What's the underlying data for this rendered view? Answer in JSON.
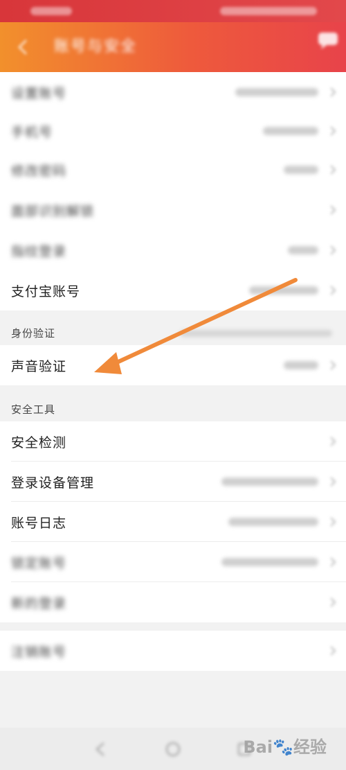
{
  "header": {
    "title": "账号与安全"
  },
  "rows_top": [
    {
      "label": "设置账号"
    },
    {
      "label": "手机号"
    },
    {
      "label": "修改密码"
    },
    {
      "label": "面部识别解锁"
    },
    {
      "label": "指纹登录"
    },
    {
      "label": "支付宝账号"
    }
  ],
  "sections": {
    "identity": "身份验证",
    "tools": "安全工具"
  },
  "identity_rows": [
    {
      "label": "声音验证"
    }
  ],
  "tool_rows": [
    {
      "label": "安全检测"
    },
    {
      "label": "登录设备管理"
    },
    {
      "label": "账号日志"
    },
    {
      "label": "锁定账号"
    },
    {
      "label": "新的登录"
    }
  ],
  "bottom_rows": [
    {
      "label": "注销账号"
    }
  ],
  "watermark": {
    "text": "Bai",
    "suffix": "经验"
  },
  "colors": {
    "header_start": "#f2902c",
    "header_end": "#e8434a",
    "arrow": "#f08a3a"
  }
}
